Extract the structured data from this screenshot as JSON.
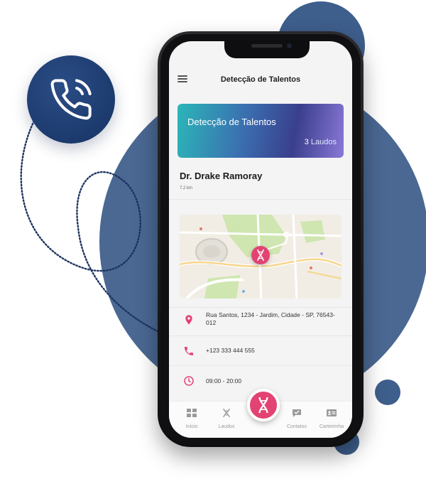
{
  "header": {
    "title": "Detecção de Talentos"
  },
  "banner": {
    "title": "Detecção de Talentos",
    "count": "3",
    "count_label": "Laudos"
  },
  "doctor": {
    "name": "Dr. Drake Ramoray",
    "distance": "7.2 km"
  },
  "details": {
    "address": "Rua Santos, 1234 - Jardim, Cidade - SP, 76543-012",
    "phone": "+123 333 444 555",
    "hours": "09:00 - 20:00"
  },
  "tabs": [
    {
      "label": "Início",
      "icon": "grid-icon"
    },
    {
      "label": "Laudos",
      "icon": "dna-icon"
    },
    {
      "label": "Contatos",
      "icon": "chat-check-icon"
    },
    {
      "label": "Carteirinha",
      "icon": "id-card-icon"
    }
  ],
  "colors": {
    "accent": "#e24372",
    "decor_blue": "#4a6892",
    "badge_blue": "#1c3a6d"
  }
}
